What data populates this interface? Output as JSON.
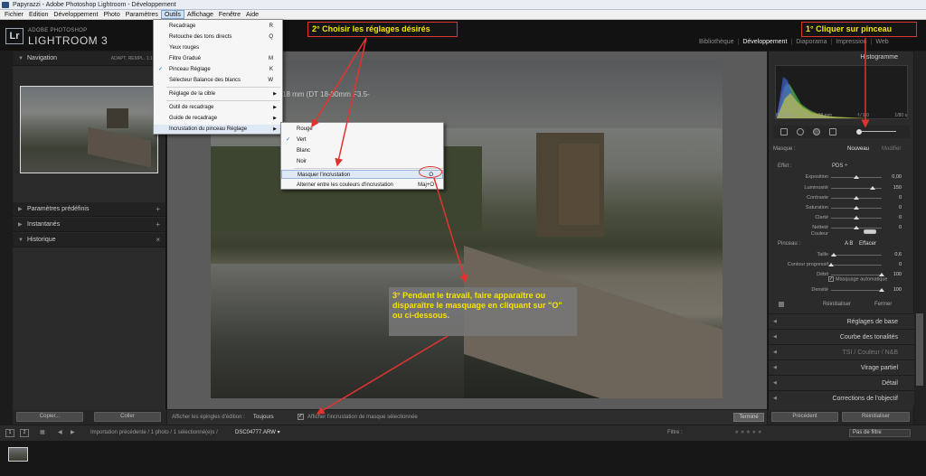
{
  "window_title": "Papyrazzi - Adobe Photoshop Lightroom - Développement",
  "menubar": [
    "Fichier",
    "Edition",
    "Développement",
    "Photo",
    "Paramètres",
    "Outils",
    "Affichage",
    "Fenêtre",
    "Aide"
  ],
  "brand": {
    "top": "ADOBE PHOTOSHOP",
    "main": "LIGHTROOM 3",
    "logo": "Lr"
  },
  "modules": [
    "Bibliothèque",
    "Développement",
    "Diaporama",
    "Impression",
    "Web"
  ],
  "left_panel": {
    "navigation": "Navigation",
    "nav_modes": "ADAPT.   REMPL.   1:1   3:1",
    "presets": "Paramètres prédéfinis",
    "snapshots": "Instantanés",
    "history": "Historique",
    "copy_btn": "Copier...",
    "paste_btn": "Coller"
  },
  "photo_info": "18 mm (DT 18-80mm F3.5-",
  "toolbar": {
    "show_pins_label": "Afficher les épingles d'édition :",
    "show_pins_value": "Toujours",
    "show_mask_label": "Afficher l'incrustation de masque sélectionnée",
    "done": "Terminé"
  },
  "right_panel": {
    "histogram": "Histogramme",
    "hist_info": [
      "ISO 100",
      "28 mm",
      "f / 9,0",
      "1/80 s"
    ],
    "mask": "Masque :",
    "mask_new": "Nouveau",
    "mask_edit": "Modifier",
    "effect": "Effet :",
    "effect_val": "PDS ÷",
    "sliders": [
      {
        "name": "Exposition",
        "value": "0,00",
        "pos": 0.5
      },
      {
        "name": "Luminosité",
        "value": "150",
        "pos": 0.82
      },
      {
        "name": "Contraste",
        "value": "0",
        "pos": 0.5
      },
      {
        "name": "Saturation",
        "value": "0",
        "pos": 0.5
      },
      {
        "name": "Clarté",
        "value": "0",
        "pos": 0.5
      },
      {
        "name": "Netteté",
        "value": "0",
        "pos": 0.5
      },
      {
        "name": "Couleur",
        "value": "",
        "pos": null
      }
    ],
    "brush": "Pinceau :",
    "brush_ab": "A   B",
    "brush_erase": "Effacer",
    "brush_sliders": [
      {
        "name": "Taille",
        "value": "0,6",
        "pos": 0.05
      },
      {
        "name": "Contour progressif",
        "value": "0",
        "pos": 0.0
      },
      {
        "name": "Débit",
        "value": "100",
        "pos": 1.0
      }
    ],
    "auto_mask": "Masquage automatique",
    "density": {
      "name": "Densité",
      "value": "100",
      "pos": 1.0
    },
    "reset": "Réinitialiser",
    "close": "Fermer",
    "sections": [
      "Réglages de base",
      "Courbe des tonalités",
      "TSI  /  Couleur  /  N&B",
      "Virage partiel",
      "Détail",
      "Corrections de l'objectif"
    ],
    "previous": "Précédent",
    "reset_btn": "Réinitialiser"
  },
  "filmbar": {
    "b1": "1",
    "b2": "2",
    "path": "Importation précédente / 1 photo / 1 sélectionné(e)s / ",
    "file": "DSC04777.ARW ▾",
    "filter": "Filtre :",
    "stars": "★★★★★",
    "filter_select": "Pas de filtre"
  },
  "outils_menu": [
    {
      "label": "Recadrage",
      "shortcut": "R"
    },
    {
      "label": "Retouche des tons directs",
      "shortcut": "Q"
    },
    {
      "label": "Yeux rouges",
      "shortcut": ""
    },
    {
      "label": "Filtre Gradué",
      "shortcut": "M"
    },
    {
      "label": "Pinceau Réglage",
      "shortcut": "K",
      "checked": true
    },
    {
      "label": "Sélecteur Balance des blancs",
      "shortcut": "W"
    },
    {
      "label": "Réglage de la cible",
      "shortcut": "",
      "arrow": true
    },
    {
      "label": "Outil de recadrage",
      "shortcut": "",
      "arrow": true
    },
    {
      "label": "Guide de recadrage",
      "shortcut": "",
      "arrow": true
    },
    {
      "label": "Incrustation du pinceau Réglage",
      "shortcut": "",
      "arrow": true
    }
  ],
  "sub_menu": [
    {
      "label": "Rouge",
      "shortcut": ""
    },
    {
      "label": "Vert",
      "shortcut": "",
      "checked": true
    },
    {
      "label": "Blanc",
      "shortcut": ""
    },
    {
      "label": "Noir",
      "shortcut": ""
    },
    {
      "label": "Masquer l'incrustation",
      "shortcut": "O"
    },
    {
      "label": "Alterner entre les couleurs d'incrustation",
      "shortcut": "Maj+O"
    }
  ],
  "annotations": {
    "step1": "1° Cliquer sur pinceau",
    "step2": "2° Choisir les réglages désirés",
    "step3": "3° Pendant le travail, faire apparaître ou disparaître le masquage en cliquant sur \"O\" ou ci-dessous."
  },
  "colors": {
    "annotation_border": "#e2342f",
    "annotation_text": "#f5e400",
    "arrow": "#e2342f"
  }
}
